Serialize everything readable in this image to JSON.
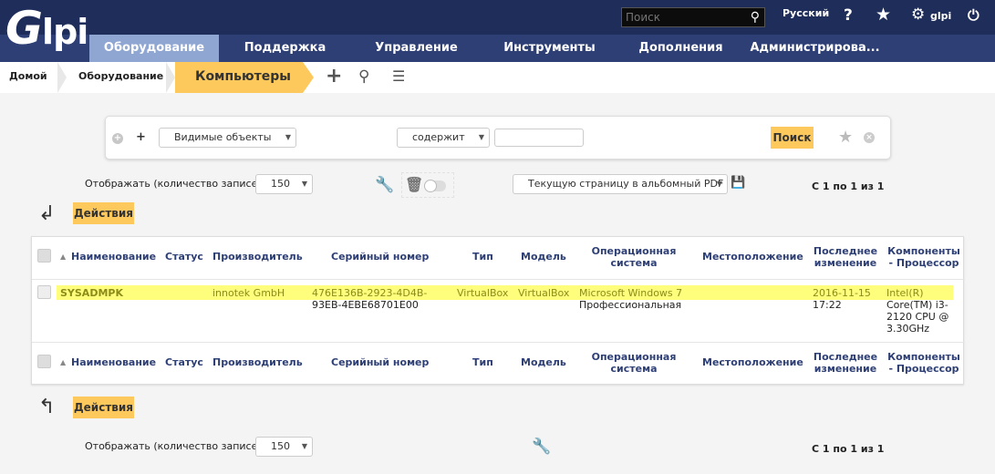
{
  "header": {
    "logo_text": "Glpi",
    "search_placeholder": "Поиск",
    "language": "Русский",
    "user": "glpi",
    "icons": [
      "search-icon",
      "help-icon",
      "star-icon",
      "gear-icon",
      "power-icon"
    ]
  },
  "menu": [
    {
      "label": "Оборудование",
      "active": true
    },
    {
      "label": "Поддержка"
    },
    {
      "label": "Управление"
    },
    {
      "label": "Инструменты"
    },
    {
      "label": "Дополнения"
    },
    {
      "label": "Администрирова..."
    }
  ],
  "breadcrumb": {
    "home": "Домой",
    "section": "Оборудование",
    "current": "Компьютеры"
  },
  "criteria": {
    "field": "Видимые объекты",
    "operator": "содержит",
    "value": "",
    "search_button": "Поиск"
  },
  "pager_top": {
    "display_label": "Отображать (количество записей)",
    "per_page": "150",
    "export": "Текущую страницу в альбомный PDF",
    "range": "С 1 по 1 из 1"
  },
  "actions_label": "Действия",
  "table": {
    "columns": [
      "Наименование",
      "Статус",
      "Производитель",
      "Серийный номер",
      "Тип",
      "Модель",
      "Операционная система",
      "Местоположение",
      "Последнее изменение",
      "Компоненты - Процессор"
    ],
    "rows": [
      {
        "name": "SYSADMPK",
        "status": "",
        "manufacturer": "innotek GmbH",
        "serial": "476E136B-2923-4D4B-93EB-4EBE68701E00",
        "serial_l1": "476E136B-2923-4D4B-",
        "serial_l2": "93EB-4EBE68701E00",
        "type": "VirtualBox",
        "model": "VirtualBox",
        "os_l1": "Microsoft Windows 7",
        "os_l2": "Профессиональная",
        "location": "",
        "modified_l1": "2016-11-15",
        "modified_l2": "17:22",
        "cpu_l1": "Intel(R)",
        "cpu_l2": "Core(TM) i3-",
        "cpu_l3": "2120 CPU @",
        "cpu_l4": "3.30GHz"
      }
    ]
  },
  "pager_bottom": {
    "display_label": "Отображать (количество записей)",
    "per_page": "150",
    "range": "С 1 по 1 из 1"
  }
}
